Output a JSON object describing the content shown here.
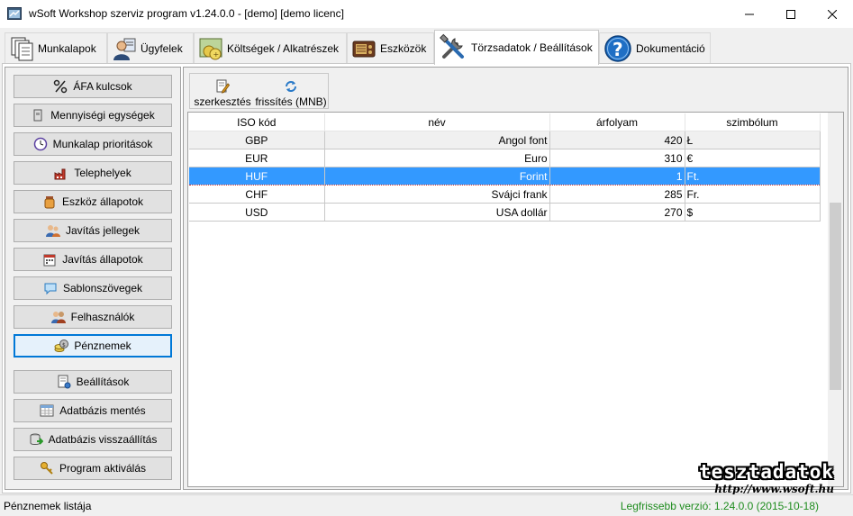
{
  "window": {
    "title": "wSoft Workshop szerviz program v1.24.0.0 - [demo] [demo licenc]",
    "minimize_glyph": "—",
    "maximize_glyph": "☐",
    "close_glyph": "✕"
  },
  "tabs": [
    {
      "label": "Munkalapok",
      "icon": "documents-icon"
    },
    {
      "label": "Ügyfelek",
      "icon": "customer-icon"
    },
    {
      "label": "Költségek / Alkatrészek",
      "icon": "costs-icon"
    },
    {
      "label": "Eszközök",
      "icon": "device-icon"
    },
    {
      "label": "Törzsadatok / Beállítások",
      "icon": "tools-icon",
      "active": true
    },
    {
      "label": "Dokumentáció",
      "icon": "help-icon"
    }
  ],
  "sidebar": {
    "items": [
      {
        "label": "ÁFA kulcsok",
        "icon": "percent-icon"
      },
      {
        "label": "Mennyiségi egységek",
        "icon": "box-icon"
      },
      {
        "label": "Munkalap prioritások",
        "icon": "clock-icon"
      },
      {
        "label": "Telephelyek",
        "icon": "factory-icon"
      },
      {
        "label": "Eszköz állapotok",
        "icon": "jar-icon"
      },
      {
        "label": "Javítás jellegek",
        "icon": "people-icon"
      },
      {
        "label": "Javítás állapotok",
        "icon": "calendar-icon"
      },
      {
        "label": "Sablonszövegek",
        "icon": "speech-bubble-icon"
      },
      {
        "label": "Felhasználók",
        "icon": "users-icon"
      },
      {
        "label": "Pénznemek",
        "icon": "coins-icon",
        "selected": true
      }
    ],
    "bottom_items": [
      {
        "label": "Beállítások",
        "icon": "settings-doc-icon"
      },
      {
        "label": "Adatbázis mentés",
        "icon": "database-save-icon"
      },
      {
        "label": "Adatbázis visszaállítás",
        "icon": "database-restore-icon"
      },
      {
        "label": "Program aktiválás",
        "icon": "key-icon"
      }
    ]
  },
  "toolbar": {
    "edit_label": "szerkesztés",
    "refresh_label": "frissítés (MNB)"
  },
  "grid": {
    "columns": [
      "ISO kód",
      "név",
      "árfolyam",
      "szimbólum"
    ],
    "rows": [
      {
        "iso": "GBP",
        "name": "Angol font",
        "rate": "420",
        "symbol": "Ł"
      },
      {
        "iso": "EUR",
        "name": "Euro",
        "rate": "310",
        "symbol": "€"
      },
      {
        "iso": "HUF",
        "name": "Forint",
        "rate": "1",
        "symbol": "Ft.",
        "selected": true
      },
      {
        "iso": "CHF",
        "name": "Svájci frank",
        "rate": "285",
        "symbol": "Fr."
      },
      {
        "iso": "USD",
        "name": "USA dollár",
        "rate": "270",
        "symbol": "$"
      }
    ]
  },
  "status": {
    "left": "Pénznemek listája",
    "right": "Legfrissebb verzió: 1.24.0.0 (2015-10-18)"
  },
  "brand": {
    "name": "tesztadatok",
    "url": "http://www.wsoft.hu"
  },
  "colors": {
    "selection": "#3399ff",
    "accent": "#0078d7",
    "status_green": "#1e8c1e"
  }
}
